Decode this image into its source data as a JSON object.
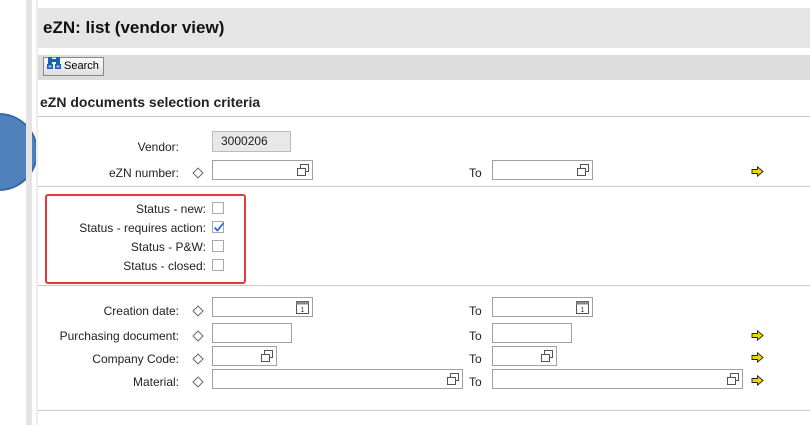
{
  "header": {
    "title": "eZN: list (vendor view)"
  },
  "toolbar": {
    "search_label": "Search"
  },
  "section": {
    "title": "eZN documents selection criteria"
  },
  "fields": {
    "vendor": {
      "label": "Vendor:",
      "value": "3000206"
    },
    "ezn_number": {
      "label": "eZN number:",
      "from": "",
      "to": "",
      "to_label": "To"
    },
    "creation_date": {
      "label": "Creation date:",
      "from": "",
      "to": "",
      "to_label": "To"
    },
    "purchasing_document": {
      "label": "Purchasing document:",
      "from": "",
      "to": "",
      "to_label": "To"
    },
    "company_code": {
      "label": "Company Code:",
      "from": "",
      "to": "",
      "to_label": "To"
    },
    "material": {
      "label": "Material:",
      "from": "",
      "to": "",
      "to_label": "To"
    }
  },
  "statuses": [
    {
      "label": "Status - new:",
      "checked": false
    },
    {
      "label": "Status - requires action:",
      "checked": true
    },
    {
      "label": "Status - P&W:",
      "checked": false
    },
    {
      "label": "Status - closed:",
      "checked": false
    }
  ],
  "colors": {
    "highlight": "#e03a3a",
    "arrow": "#f2d600",
    "checkmark": "#1f6fd0",
    "decor_circle": "#4f81bd"
  },
  "icons": {
    "search": "binoculars-icon",
    "multiple_selection": "multiple-selection-icon",
    "calendar": "calendar-icon",
    "more": "yellow-arrow-icon",
    "include": "diamond-icon"
  }
}
